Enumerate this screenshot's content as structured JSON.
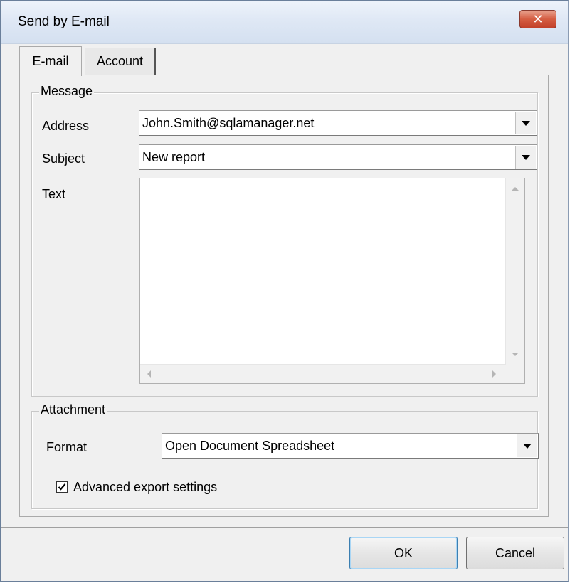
{
  "window": {
    "title": "Send by E-mail"
  },
  "tabs": [
    {
      "label": "E-mail",
      "active": true
    },
    {
      "label": "Account",
      "active": false
    }
  ],
  "message": {
    "group_label": "Message",
    "address": {
      "label": "Address",
      "value": "John.Smith@sqlamanager.net"
    },
    "subject": {
      "label": "Subject",
      "value": "New report"
    },
    "text": {
      "label": "Text",
      "value": ""
    }
  },
  "attachment": {
    "group_label": "Attachment",
    "format": {
      "label": "Format",
      "value": "Open Document Spreadsheet"
    },
    "advanced": {
      "label": "Advanced export settings",
      "checked": true
    }
  },
  "buttons": {
    "ok": "OK",
    "cancel": "Cancel"
  },
  "colors": {
    "close_button": "#d55d42",
    "default_button_border": "#3c7fb1"
  }
}
